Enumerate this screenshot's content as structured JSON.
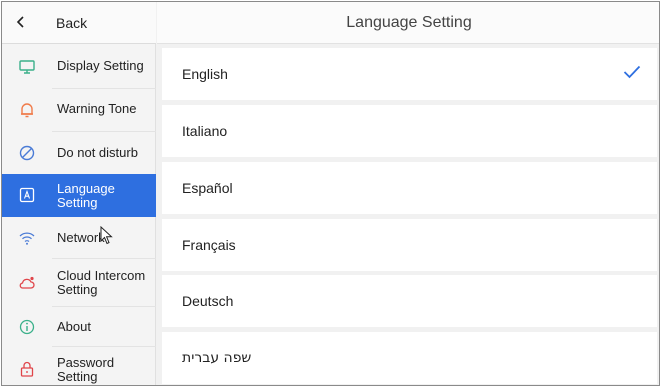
{
  "header": {
    "title": "Language Setting"
  },
  "sidebar": {
    "back_label": "Back",
    "items": [
      {
        "label": "Display Setting",
        "icon": "monitor-icon"
      },
      {
        "label": "Warning Tone",
        "icon": "bell-icon"
      },
      {
        "label": "Do not disturb",
        "icon": "do-not-disturb-icon"
      },
      {
        "label": "Language Setting",
        "icon": "language-icon",
        "active": true
      },
      {
        "label": "Network",
        "icon": "wifi-icon"
      },
      {
        "label": "Cloud Intercom Setting",
        "icon": "cloud-icon"
      },
      {
        "label": "About",
        "icon": "info-icon"
      },
      {
        "label": "Password Setting",
        "icon": "lock-icon"
      }
    ]
  },
  "languages": [
    {
      "name": "English",
      "selected": true
    },
    {
      "name": "Italiano"
    },
    {
      "name": "Español"
    },
    {
      "name": "Français"
    },
    {
      "name": "Deutsch"
    },
    {
      "name": "שפה עברית"
    }
  ],
  "colors": {
    "accent": "#2e6fe0",
    "icon_green": "#3bb08a",
    "icon_orange": "#f07b4a",
    "icon_blue": "#4a7bd6",
    "icon_red": "#e0454a"
  }
}
